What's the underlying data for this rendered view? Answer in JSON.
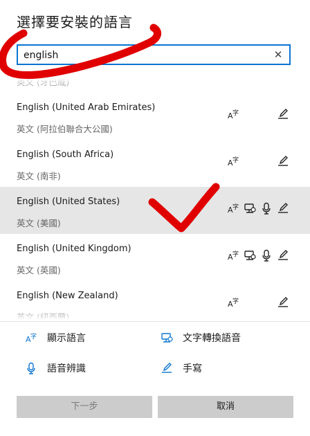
{
  "dialog": {
    "title": "選擇要安裝的語言",
    "search_value": "english"
  },
  "languages": [
    {
      "name": "",
      "native": "英文 (牙巴威)",
      "icons": [],
      "selected": false
    },
    {
      "name": "English (United Arab Emirates)",
      "native": "英文 (阿拉伯聯合大公國)",
      "icons": [
        "display-language-icon",
        "",
        "",
        "handwriting-icon"
      ],
      "selected": false
    },
    {
      "name": "English (South Africa)",
      "native": "英文 (南非)",
      "icons": [
        "display-language-icon",
        "",
        "",
        "handwriting-icon"
      ],
      "selected": false
    },
    {
      "name": "English (United States)",
      "native": "英文 (美國)",
      "icons": [
        "display-language-icon",
        "text-to-speech-icon",
        "speech-recognition-icon",
        "handwriting-icon"
      ],
      "selected": true
    },
    {
      "name": "English (United Kingdom)",
      "native": "英文 (英國)",
      "icons": [
        "display-language-icon",
        "text-to-speech-icon",
        "speech-recognition-icon",
        "handwriting-icon"
      ],
      "selected": false
    },
    {
      "name": "English (New Zealand)",
      "native": "英文 (紐西蘭)",
      "icons": [
        "display-language-icon",
        "",
        "",
        "handwriting-icon"
      ],
      "selected": false
    }
  ],
  "legend": {
    "display_language": "顯示語言",
    "text_to_speech": "文字轉換語音",
    "speech_recognition": "語音辨識",
    "handwriting": "手寫"
  },
  "buttons": {
    "next": "下一步",
    "cancel": "取消"
  },
  "colors": {
    "accent": "#0a74d1",
    "annotation": "#e00000",
    "selected_row": "#e6e6e6"
  }
}
